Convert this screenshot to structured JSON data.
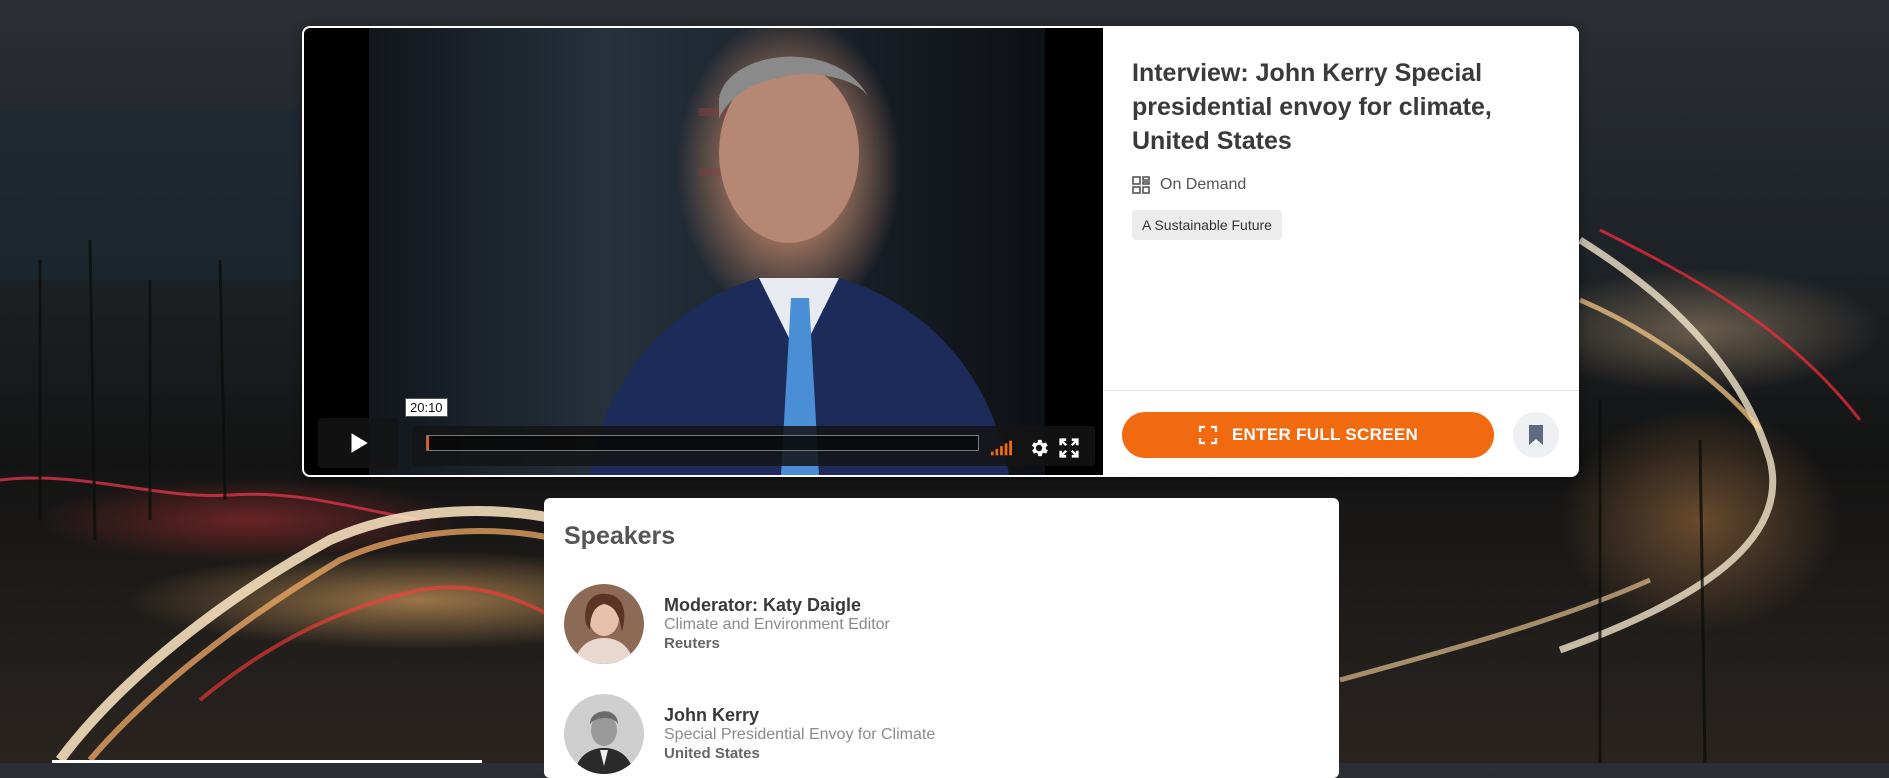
{
  "video": {
    "timestamp": "20:10",
    "progress_fraction": 0.004,
    "controls": {
      "play_icon": "play-icon",
      "volume_icon": "volume-bars-icon",
      "settings_icon": "gear-icon",
      "fullscreen_icon": "fullscreen-icon"
    }
  },
  "session": {
    "title": "Interview: John Kerry Special presidential envoy for climate, United States",
    "format": "On Demand",
    "format_icon": "on-demand-icon",
    "tag": "A Sustainable Future"
  },
  "actions": {
    "enter_full_screen": "ENTER FULL SCREEN",
    "bookmark_icon": "bookmark-icon"
  },
  "speakers": {
    "heading": "Speakers",
    "items": [
      {
        "name": "Moderator: Katy Daigle",
        "role": "Climate and Environment Editor",
        "org": "Reuters"
      },
      {
        "name": "John Kerry",
        "role": "Special Presidential Envoy for Climate",
        "org": "United States"
      }
    ]
  },
  "colors": {
    "accent": "#f26a10",
    "title_text": "#3a3a3a",
    "tag_bg": "#ececec"
  }
}
